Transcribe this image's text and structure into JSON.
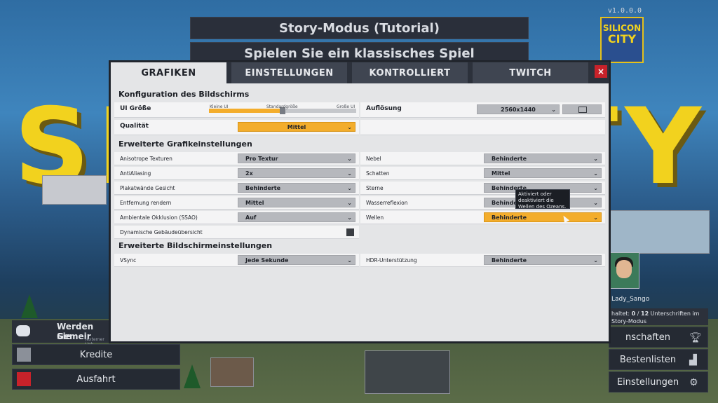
{
  "background": {
    "logo_left": "SIL",
    "logo_right": "ITY",
    "version": "v1.0.0.0",
    "game_logo_top": "SILICON",
    "game_logo_bottom": "CITY"
  },
  "top_menu": {
    "story_mode": "Story-Modus (Tutorial)",
    "classic": "Spielen Sie ein klassisches Spiel"
  },
  "left_menu": {
    "discord_line1": "Werden Sie",
    "discord_line2": "Gemeir",
    "discord_line3": "(externer Link",
    "credits": "Kredite",
    "exit": "Ausfahrt"
  },
  "right_menu": {
    "player_name": "Lady_Sango",
    "progress_prefix": "haltet: ",
    "progress_current": "0",
    "progress_sep": " / ",
    "progress_total": "12",
    "progress_suffix": " Unterschriften im",
    "progress_line2": "Story-Modus",
    "achievements": "nschaften",
    "leaderboards": "Bestenlisten",
    "settings": "Einstellungen"
  },
  "tabs": [
    "GRAFIKEN",
    "EINSTELLUNGEN",
    "KONTROLLIERT",
    "TWITCH"
  ],
  "close_label": "×",
  "sections": {
    "screen": "Konfiguration des Bildschirms",
    "graphics": "Erweiterte Grafikeinstellungen",
    "display": "Erweiterte Bildschirmeinstellungen"
  },
  "screen_config": {
    "ui_size_label": "UI Größe",
    "ui_size_ticks": [
      "Kleine UI",
      "Standardgröße",
      "Große UI"
    ],
    "ui_size_value": 0.5,
    "resolution_label": "Auflösung",
    "resolution_value": "2560x1440",
    "quality_label": "Qualität",
    "quality_value": "Mittel"
  },
  "graphics_left": [
    {
      "label": "Anisotrope Texturen",
      "value": "Pro Textur"
    },
    {
      "label": "AntiAliasing",
      "value": "2x"
    },
    {
      "label": "Plakatwände Gesicht",
      "value": "Behinderte"
    },
    {
      "label": "Entfernung rendern",
      "value": "Mittel"
    },
    {
      "label": "Ambientale Okklusion (SSAO)",
      "value": "Auf"
    },
    {
      "label": "Dynamische Gebäudeübersicht",
      "value": ""
    }
  ],
  "graphics_right": [
    {
      "label": "Nebel",
      "value": "Behinderte"
    },
    {
      "label": "Schatten",
      "value": "Mittel"
    },
    {
      "label": "Sterne",
      "value": "Behinderte"
    },
    {
      "label": "Wasserreflexion",
      "value": "Behinderte"
    },
    {
      "label": "Wellen",
      "value": "Behinderte"
    }
  ],
  "display": {
    "vsync_label": "VSync",
    "vsync_value": "Jede Sekunde",
    "hdr_label": "HDR-Unterstützung",
    "hdr_value": "Behinderte"
  },
  "tooltip": "Aktiviert oder deaktiviert die Wellen des Ozeans.",
  "colors": {
    "accent": "#f3ad2c",
    "close": "#c8222a",
    "panel": "#e4e5e7"
  }
}
